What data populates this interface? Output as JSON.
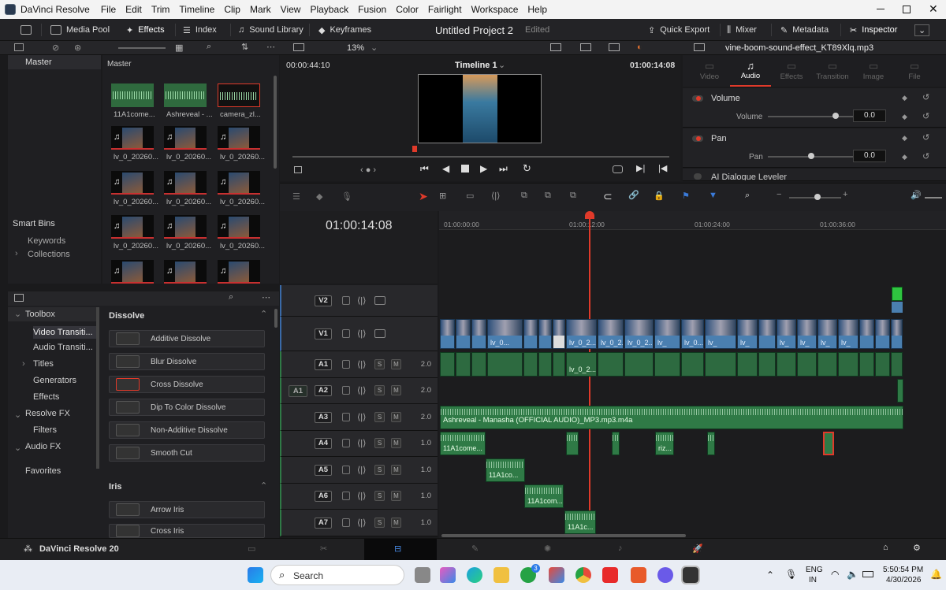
{
  "window": {
    "app_name": "DaVinci Resolve",
    "menu": [
      "File",
      "Edit",
      "Trim",
      "Timeline",
      "Clip",
      "Mark",
      "View",
      "Playback",
      "Fusion",
      "Color",
      "Fairlight",
      "Workspace",
      "Help"
    ]
  },
  "toolbar": {
    "media_pool": "Media Pool",
    "effects": "Effects",
    "index": "Index",
    "sound_library": "Sound Library",
    "keyframes": "Keyframes",
    "project_title": "Untitled Project 2",
    "project_status": "Edited",
    "quick_export": "Quick Export",
    "mixer": "Mixer",
    "metadata": "Metadata",
    "inspector": "Inspector"
  },
  "subbar": {
    "zoom": "13%",
    "clip_name": "vine-boom-sound-effect_KT89Xlq.mp3"
  },
  "bins": {
    "master": "Master",
    "smart_bins": "Smart Bins",
    "keywords": "Keywords",
    "collections": "Collections"
  },
  "media_pool": {
    "header": "Master",
    "clips": [
      {
        "label": "11A1come...",
        "kind": "audio"
      },
      {
        "label": "Ashreveal - ...",
        "kind": "audio"
      },
      {
        "label": "camera_zl...",
        "kind": "audio-selected"
      },
      {
        "label": "lv_0_20260...",
        "kind": "video"
      },
      {
        "label": "lv_0_20260...",
        "kind": "video"
      },
      {
        "label": "lv_0_20260...",
        "kind": "video"
      },
      {
        "label": "lv_0_20260...",
        "kind": "video"
      },
      {
        "label": "lv_0_20260...",
        "kind": "video"
      },
      {
        "label": "lv_0_20260...",
        "kind": "video"
      },
      {
        "label": "lv_0_20260...",
        "kind": "video"
      },
      {
        "label": "lv_0_20260...",
        "kind": "video"
      },
      {
        "label": "lv_0_20260...",
        "kind": "video"
      },
      {
        "label": "",
        "kind": "video"
      },
      {
        "label": "",
        "kind": "video"
      },
      {
        "label": "",
        "kind": "video"
      }
    ]
  },
  "toolbox": {
    "items": [
      "Toolbox",
      "Video Transiti...",
      "Audio Transiti...",
      "Titles",
      "Generators",
      "Effects",
      "Resolve FX",
      "Filters",
      "Audio FX",
      "Favorites"
    ]
  },
  "effects": {
    "dissolve_header": "Dissolve",
    "dissolve": [
      "Additive Dissolve",
      "Blur Dissolve",
      "Cross Dissolve",
      "Dip To Color Dissolve",
      "Non-Additive Dissolve",
      "Smooth Cut"
    ],
    "iris_header": "Iris",
    "iris": [
      "Arrow Iris",
      "Cross Iris"
    ]
  },
  "viewer": {
    "source_tc": "00:00:44:10",
    "timeline_name": "Timeline 1",
    "record_tc": "01:00:14:08"
  },
  "inspector": {
    "tabs": [
      "Video",
      "Audio",
      "Effects",
      "Transition",
      "Image",
      "File"
    ],
    "active_tab": "Audio",
    "volume_title": "Volume",
    "volume_label": "Volume",
    "volume_value": "0.0",
    "volume_level": 0.78,
    "pan_title": "Pan",
    "pan_label": "Pan",
    "pan_value": "0.0",
    "pan_level": 0.5,
    "dialogue": "AI Dialogue Leveler"
  },
  "timeline": {
    "timecode": "01:00:14:08",
    "ruler": [
      "01:00:00:00",
      "01:00:12:00",
      "01:00:24:00",
      "01:00:36:00"
    ],
    "tracks": [
      {
        "id": "V2",
        "type": "video",
        "vol": ""
      },
      {
        "id": "V1",
        "type": "video",
        "vol": ""
      },
      {
        "id": "A1",
        "type": "audio",
        "vol": "2.0"
      },
      {
        "id": "A2",
        "type": "audio",
        "vol": "2.0",
        "patch": "A1"
      },
      {
        "id": "A3",
        "type": "audio",
        "vol": "2.0"
      },
      {
        "id": "A4",
        "type": "audio",
        "vol": "1.0"
      },
      {
        "id": "A5",
        "type": "audio",
        "vol": "1.0"
      },
      {
        "id": "A6",
        "type": "audio",
        "vol": "1.0"
      },
      {
        "id": "A7",
        "type": "audio",
        "vol": "1.0"
      }
    ],
    "v1_clip_label": "lv_0...",
    "v1_clip_label2": "lv_0_2...",
    "v1_clip_label3": "lv_0_2...",
    "v1_short": "lv_",
    "a3_clip": "Ashreveal - Manasha (OFFICIAL AUDIO)_MP3.mp3.m4a",
    "a4_clip": "11A1come...",
    "a4_clip2": "riz...",
    "a5_clip": "11A1co...",
    "a6_clip": "11A1com...",
    "a7_clip": "11A1c..."
  },
  "bottom": {
    "brand": "DaVinci Resolve 20"
  },
  "taskbar": {
    "search": "Search",
    "lang1": "ENG",
    "lang2": "IN",
    "time": "5:50:54 PM",
    "date": "4/30/2026",
    "whatsapp_badge": "3"
  },
  "colors": {
    "accent_red": "#e03a2a",
    "video_clip": "#4a7fb0",
    "audio_clip": "#2f7a46"
  }
}
